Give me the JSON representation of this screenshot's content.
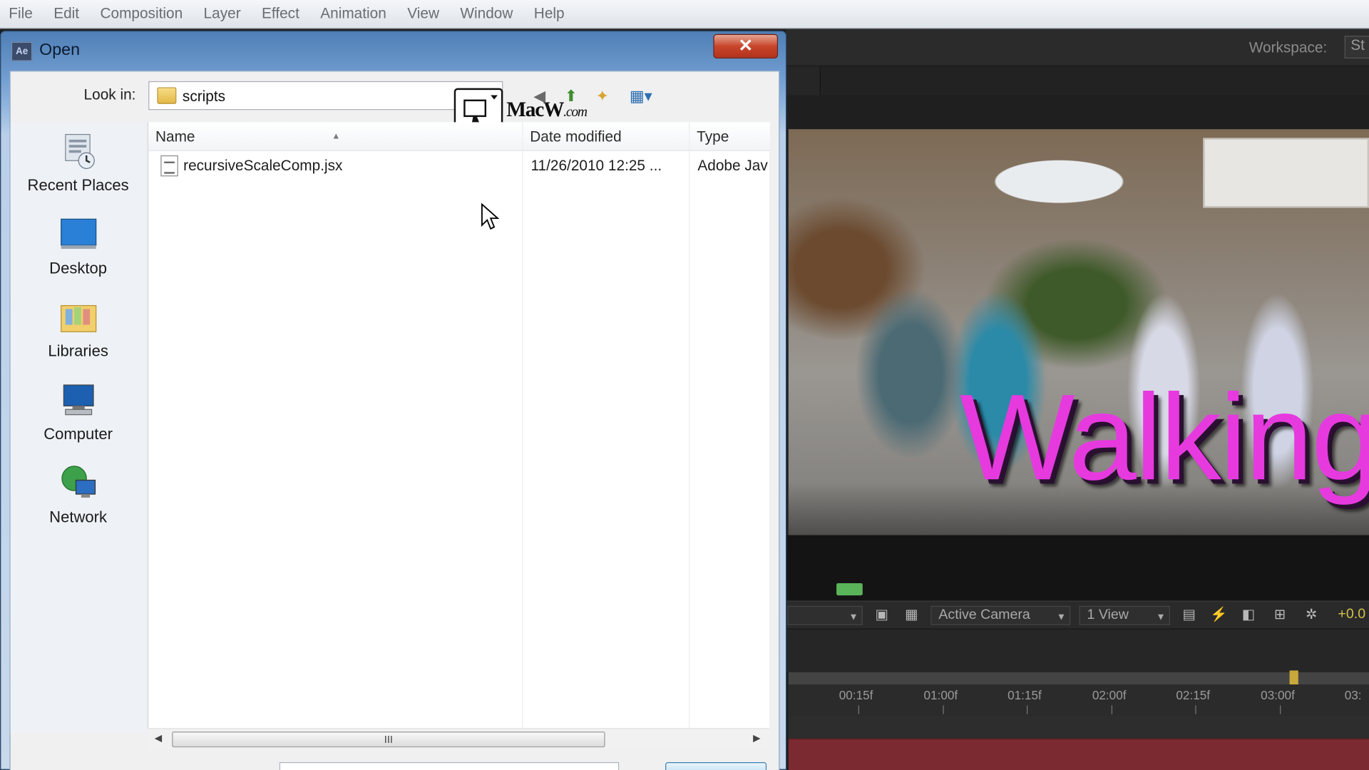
{
  "menubar": {
    "items": [
      "File",
      "Edit",
      "Composition",
      "Layer",
      "Effect",
      "Animation",
      "View",
      "Window",
      "Help"
    ]
  },
  "workspace": {
    "label": "Workspace:",
    "value": "St"
  },
  "dialog": {
    "title": "Open",
    "app_badge": "Ae",
    "close_glyph": "✕",
    "look_in_label": "Look in:",
    "look_in_value": "scripts",
    "watermark": {
      "brand": "MacW",
      "suffix": ".com"
    },
    "places": [
      "Recent Places",
      "Desktop",
      "Libraries",
      "Computer",
      "Network"
    ],
    "columns": [
      "Name",
      "Date modified",
      "Type"
    ],
    "files": [
      {
        "name": "recursiveScaleComp.jsx",
        "date": "11/26/2010 12:25 ...",
        "type": "Adobe Jav"
      }
    ],
    "scroll_thumb_grip": "III"
  },
  "viewer": {
    "title_text": "Walking",
    "toolbar": {
      "camera": "Active Camera",
      "views": "1 View",
      "exposure": "+0.0"
    }
  },
  "timeline": {
    "ticks": [
      "00:15f",
      "01:00f",
      "01:15f",
      "02:00f",
      "02:15f",
      "03:00f",
      "03:"
    ]
  },
  "colors": {
    "title_magenta": "#e63adf",
    "dialog_blue": "#6f9cd0",
    "close_red": "#c8452b"
  }
}
